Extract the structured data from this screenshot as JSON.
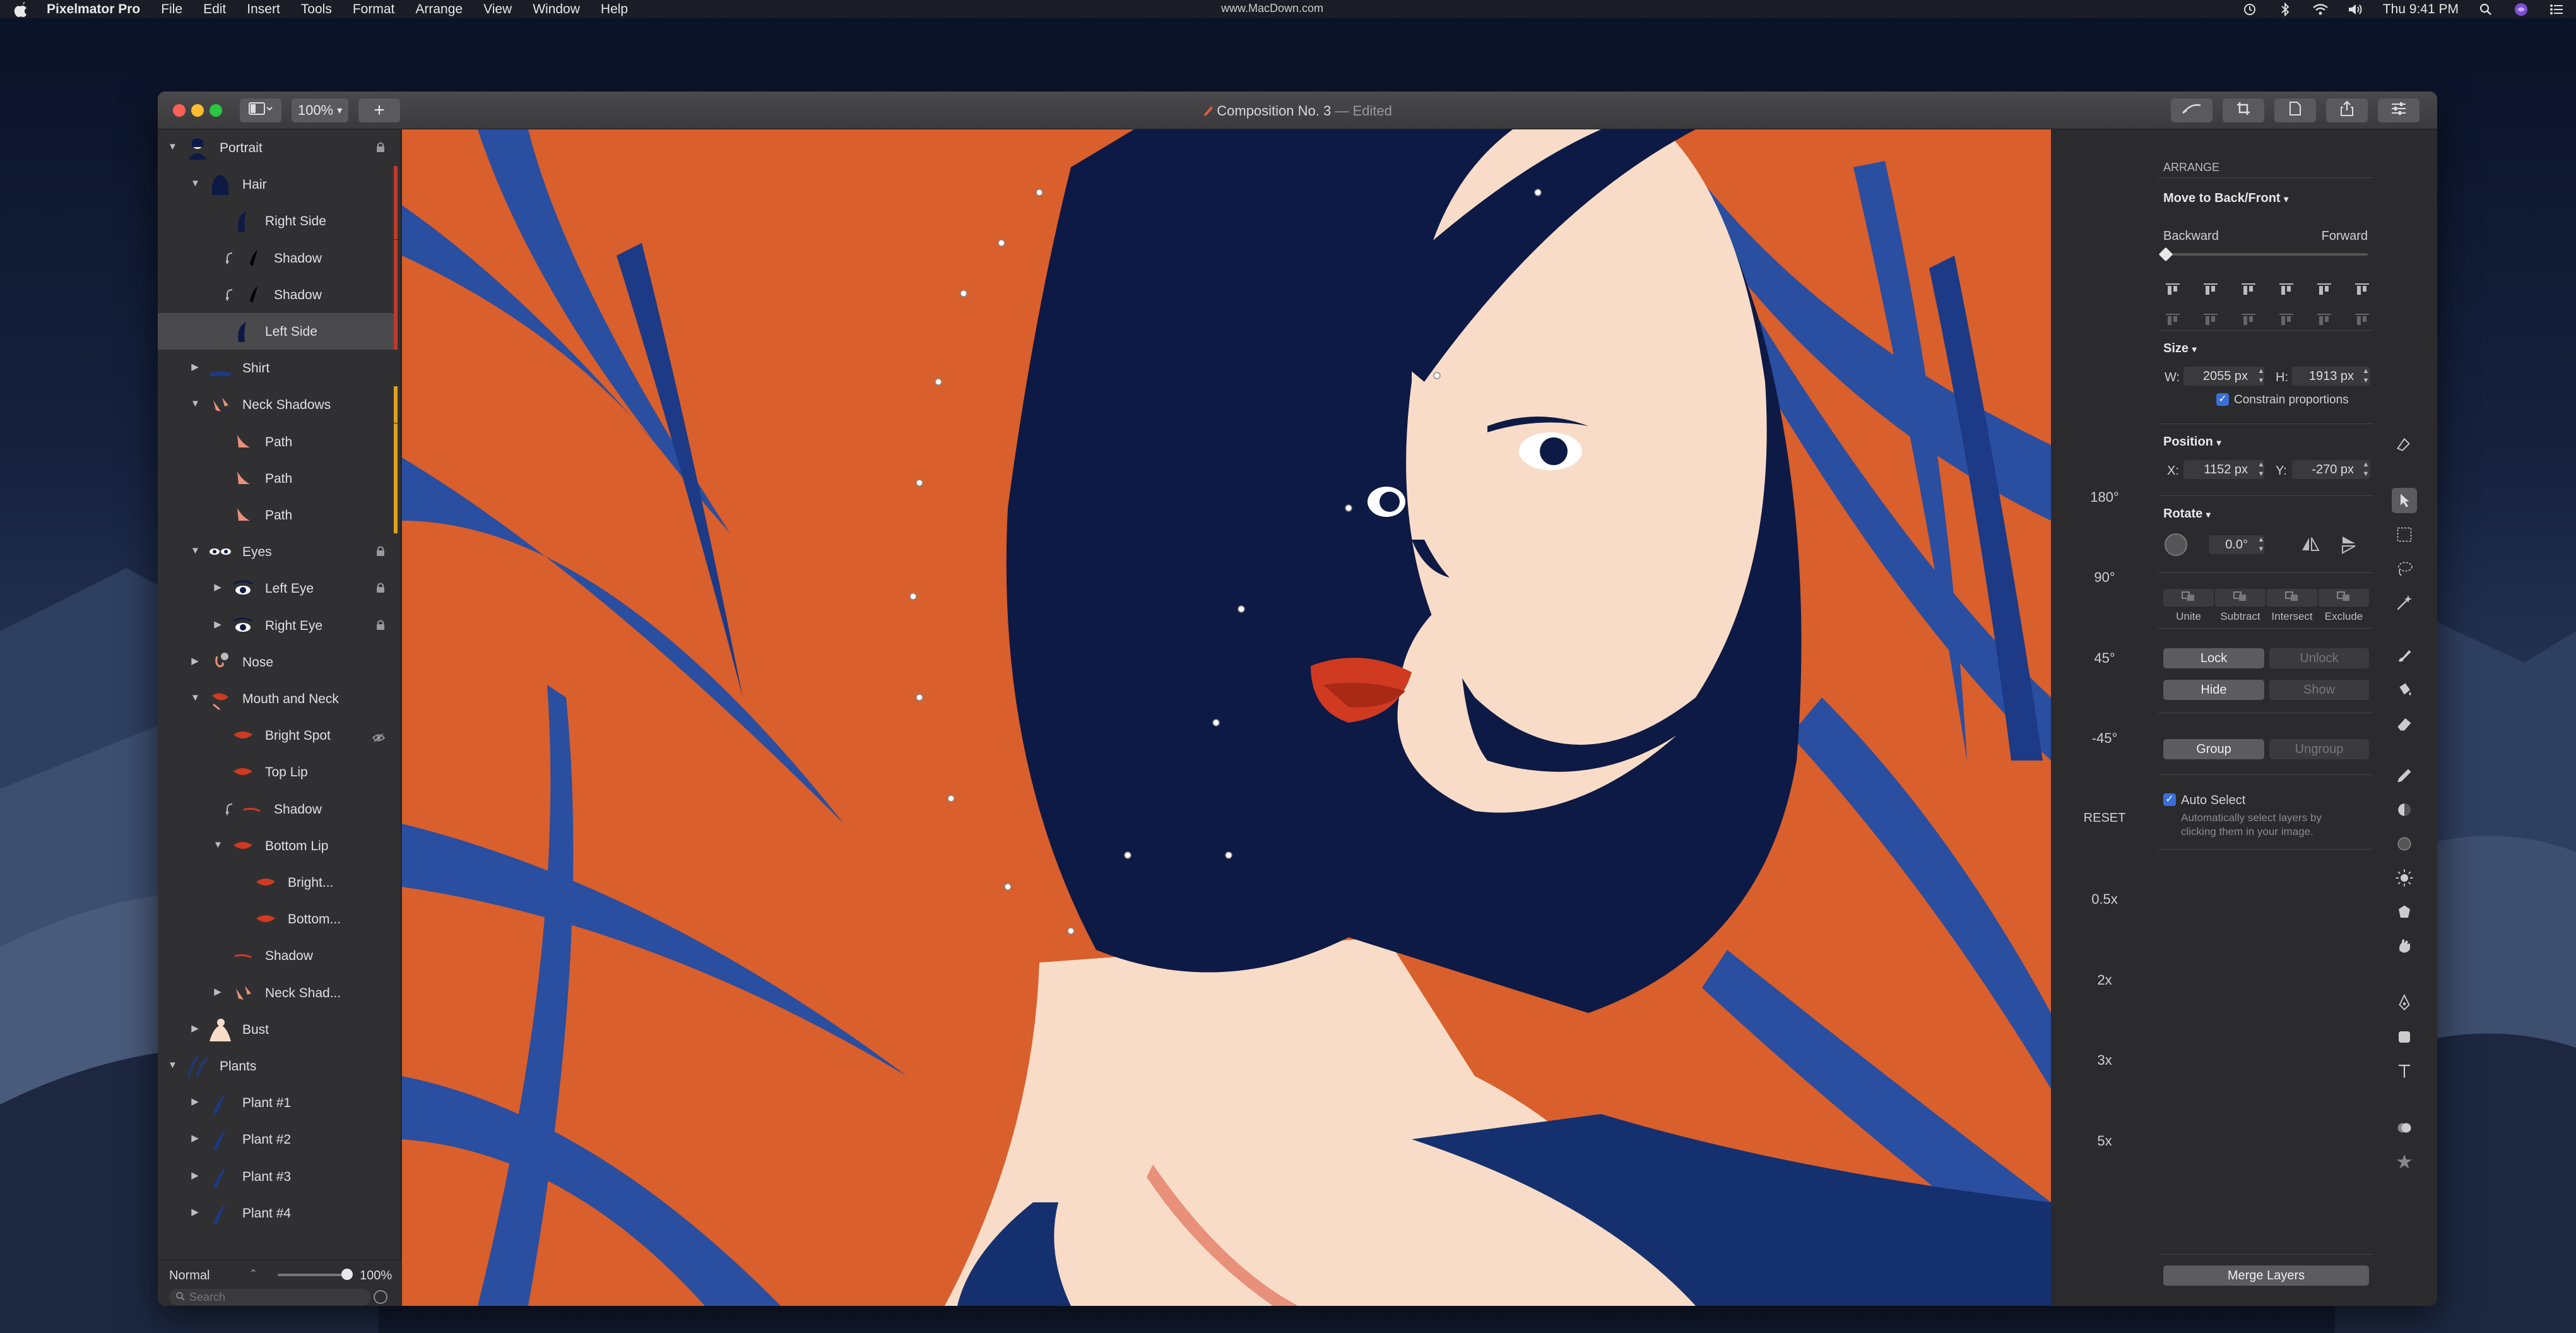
{
  "menubar": {
    "app_name": "Pixelmator Pro",
    "items": [
      "File",
      "Edit",
      "Insert",
      "Tools",
      "Format",
      "Arrange",
      "View",
      "Window",
      "Help"
    ],
    "center_text": "www.MacDown.com",
    "clock": "Thu 9:41 PM"
  },
  "window": {
    "doc_name": "Composition No. 3",
    "doc_status": "— Edited",
    "zoom": "100%"
  },
  "layers": [
    {
      "name": "Portrait",
      "indent": 0,
      "expanded": true,
      "locked": true,
      "thumb": "portrait"
    },
    {
      "name": "Hair",
      "indent": 1,
      "expanded": true,
      "thumb": "hair",
      "bar": "#c0392b"
    },
    {
      "name": "Right Side",
      "indent": 2,
      "thumb": "hair-side",
      "bar": "#c0392b"
    },
    {
      "name": "Shadow",
      "indent": 2,
      "clip": true,
      "thumb": "hair-shadow",
      "bar": "#c0392b"
    },
    {
      "name": "Shadow",
      "indent": 2,
      "clip": true,
      "thumb": "hair-shadow",
      "bar": "#c0392b"
    },
    {
      "name": "Left Side",
      "indent": 2,
      "selected": true,
      "thumb": "hair-side",
      "bar": "#c0392b"
    },
    {
      "name": "Shirt",
      "indent": 1,
      "expanded": false,
      "thumb": "shirt"
    },
    {
      "name": "Neck Shadows",
      "indent": 1,
      "expanded": true,
      "thumb": "neck",
      "bar": "#e0a020"
    },
    {
      "name": "Path",
      "indent": 2,
      "thumb": "path",
      "bar": "#e0a020"
    },
    {
      "name": "Path",
      "indent": 2,
      "thumb": "path",
      "bar": "#e0a020"
    },
    {
      "name": "Path",
      "indent": 2,
      "thumb": "path",
      "bar": "#e0a020"
    },
    {
      "name": "Eyes",
      "indent": 1,
      "expanded": true,
      "locked": true,
      "thumb": "eyes"
    },
    {
      "name": "Left Eye",
      "indent": 2,
      "expanded": false,
      "locked": true,
      "thumb": "eye"
    },
    {
      "name": "Right Eye",
      "indent": 2,
      "expanded": false,
      "locked": true,
      "thumb": "eye"
    },
    {
      "name": "Nose",
      "indent": 1,
      "expanded": false,
      "thumb": "nose"
    },
    {
      "name": "Mouth and Neck",
      "indent": 1,
      "expanded": true,
      "thumb": "mouth"
    },
    {
      "name": "Bright Spot",
      "indent": 2,
      "hidden": true,
      "thumb": "lip"
    },
    {
      "name": "Top Lip",
      "indent": 2,
      "thumb": "lip"
    },
    {
      "name": "Shadow",
      "indent": 2,
      "clip": true,
      "thumb": "lip-shadow"
    },
    {
      "name": "Bottom Lip",
      "indent": 2,
      "expanded": true,
      "thumb": "lip"
    },
    {
      "name": "Bright...",
      "indent": 3,
      "thumb": "lip"
    },
    {
      "name": "Bottom...",
      "indent": 3,
      "thumb": "lip"
    },
    {
      "name": "Shadow",
      "indent": 2,
      "thumb": "lip-shadow"
    },
    {
      "name": "Neck Shad...",
      "indent": 2,
      "expanded": false,
      "thumb": "neck"
    },
    {
      "name": "Bust",
      "indent": 1,
      "expanded": false,
      "thumb": "bust"
    },
    {
      "name": "Plants",
      "indent": 0,
      "expanded": true,
      "thumb": "plants"
    },
    {
      "name": "Plant #1",
      "indent": 1,
      "expanded": false,
      "thumb": "plant"
    },
    {
      "name": "Plant #2",
      "indent": 1,
      "expanded": false,
      "thumb": "plant"
    },
    {
      "name": "Plant #3",
      "indent": 1,
      "expanded": false,
      "thumb": "plant"
    },
    {
      "name": "Plant #4",
      "indent": 1,
      "expanded": false,
      "thumb": "plant"
    }
  ],
  "layers_footer": {
    "blend_mode": "Normal",
    "opacity": "100%",
    "opacity_value": 1.0,
    "search_placeholder": "Search"
  },
  "rotate_presets": [
    "180°",
    "90°",
    "45°",
    "-45°",
    "RESET",
    "0.5x",
    "2x",
    "3x",
    "5x"
  ],
  "arrange": {
    "section_title": "ARRANGE",
    "move_label": "Move to Back/Front",
    "backward": "Backward",
    "forward": "Forward",
    "size_label": "Size",
    "width_label": "W:",
    "width_value": "2055 px",
    "height_label": "H:",
    "height_value": "1913 px",
    "constrain_label": "Constrain proportions",
    "position_label": "Position",
    "x_label": "X:",
    "x_value": "1152 px",
    "y_label": "Y:",
    "y_value": "-270 px",
    "rotate_label": "Rotate",
    "rotate_value": "0.0°",
    "bool_ops": [
      "Unite",
      "Subtract",
      "Intersect",
      "Exclude"
    ],
    "lock": "Lock",
    "unlock": "Unlock",
    "hide": "Hide",
    "show": "Show",
    "group": "Group",
    "ungroup": "Ungroup",
    "auto_select": "Auto Select",
    "auto_select_desc": "Automatically select layers by clicking them in your image.",
    "merge": "Merge Layers"
  },
  "colors": {
    "accent": "#3a6fd8",
    "canvas_bg": "#d95f2c",
    "hair": "#0d1a45",
    "skin": "#f9dcc8",
    "leaf": "#2a4ea0",
    "lips": "#d03a20"
  },
  "tools": [
    "pen-icon",
    "arrange-icon",
    "select-icon",
    "lasso-icon",
    "magic-wand-icon",
    "paint-brush-icon",
    "paint-bucket-icon",
    "eraser-icon",
    "pencil-icon",
    "color-adjust-icon",
    "shape-circle-icon",
    "effects-icon",
    "shape-icon",
    "smudge-icon",
    "vector-pen-icon",
    "rectangle-icon",
    "type-icon",
    "repair-icon",
    "star-icon"
  ]
}
